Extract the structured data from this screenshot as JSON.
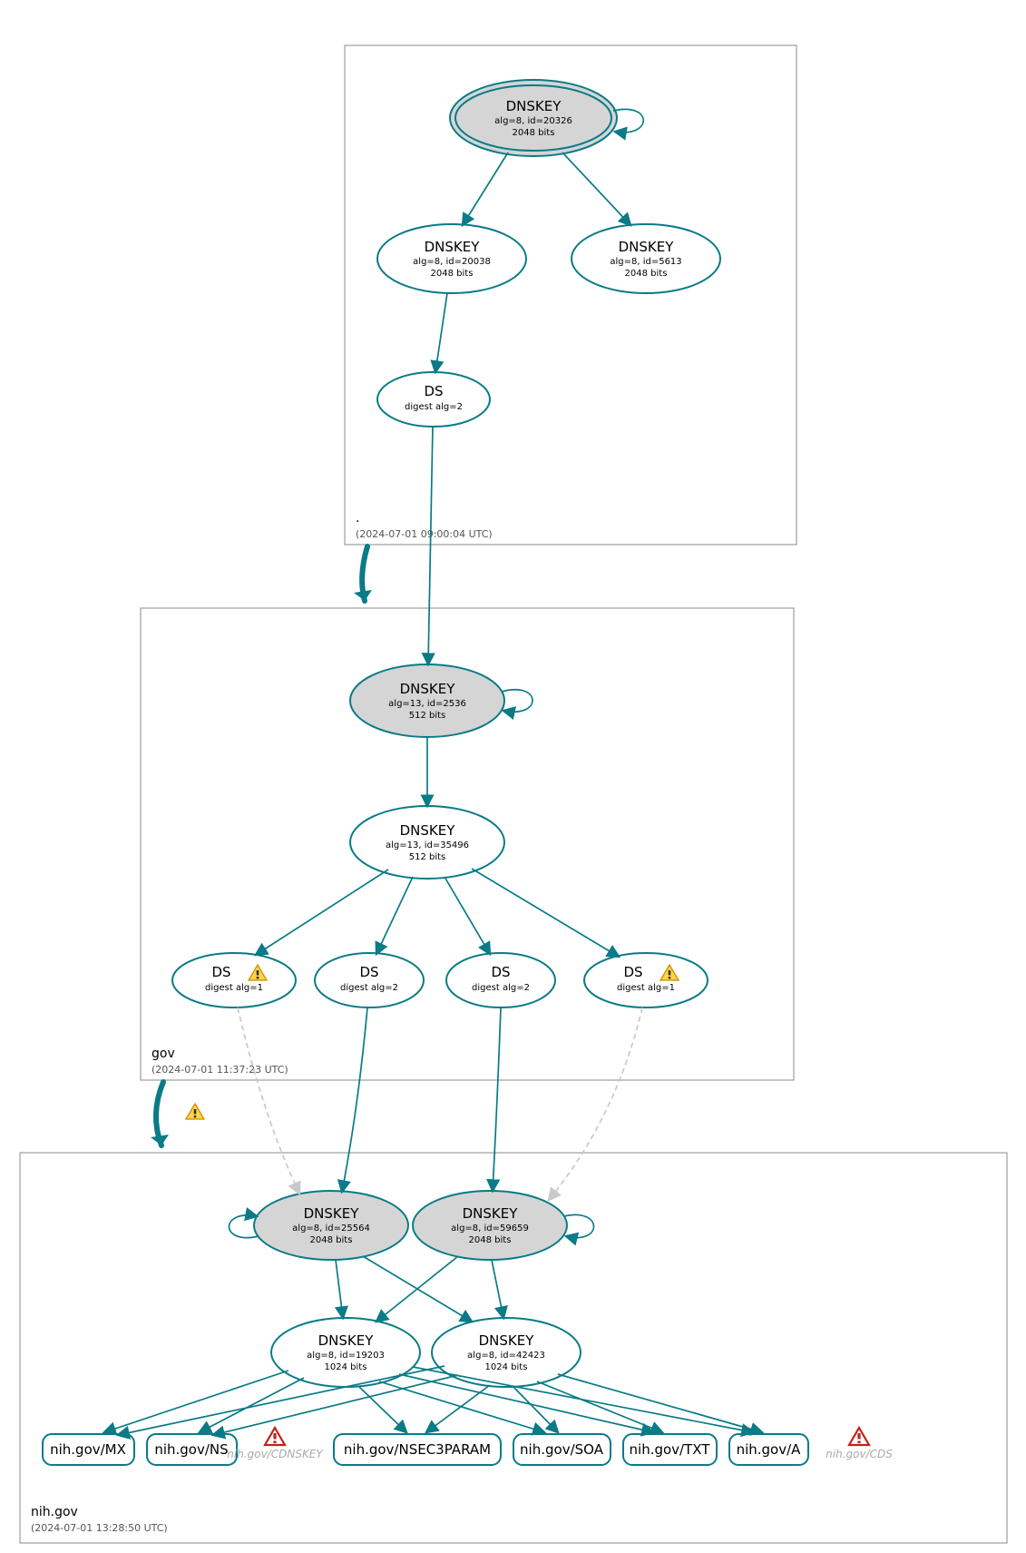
{
  "zones": {
    "root": {
      "label": ".",
      "timestamp": "(2024-07-01 09:00:04 UTC)"
    },
    "gov": {
      "label": "gov",
      "timestamp": "(2024-07-01 11:37:23 UTC)"
    },
    "nih": {
      "label": "nih.gov",
      "timestamp": "(2024-07-01 13:28:50 UTC)"
    }
  },
  "nodes": {
    "root_ksk": {
      "title": "DNSKEY",
      "l2": "alg=8, id=20326",
      "l3": "2048 bits"
    },
    "root_zsk1": {
      "title": "DNSKEY",
      "l2": "alg=8, id=20038",
      "l3": "2048 bits"
    },
    "root_zsk2": {
      "title": "DNSKEY",
      "l2": "alg=8, id=5613",
      "l3": "2048 bits"
    },
    "root_ds": {
      "title": "DS",
      "l2": "digest alg=2",
      "l3": ""
    },
    "gov_ksk": {
      "title": "DNSKEY",
      "l2": "alg=13, id=2536",
      "l3": "512 bits"
    },
    "gov_zsk": {
      "title": "DNSKEY",
      "l2": "alg=13, id=35496",
      "l3": "512 bits"
    },
    "gov_ds1": {
      "title": "DS",
      "l2": "digest alg=1",
      "l3": ""
    },
    "gov_ds2": {
      "title": "DS",
      "l2": "digest alg=2",
      "l3": ""
    },
    "gov_ds3": {
      "title": "DS",
      "l2": "digest alg=2",
      "l3": ""
    },
    "gov_ds4": {
      "title": "DS",
      "l2": "digest alg=1",
      "l3": ""
    },
    "nih_ksk1": {
      "title": "DNSKEY",
      "l2": "alg=8, id=25564",
      "l3": "2048 bits"
    },
    "nih_ksk2": {
      "title": "DNSKEY",
      "l2": "alg=8, id=59659",
      "l3": "2048 bits"
    },
    "nih_zsk1": {
      "title": "DNSKEY",
      "l2": "alg=8, id=19203",
      "l3": "1024 bits"
    },
    "nih_zsk2": {
      "title": "DNSKEY",
      "l2": "alg=8, id=42423",
      "l3": "1024 bits"
    }
  },
  "rr": {
    "mx": "nih.gov/MX",
    "ns": "nih.gov/NS",
    "cdk": "nih.gov/CDNSKEY",
    "n3p": "nih.gov/NSEC3PARAM",
    "soa": "nih.gov/SOA",
    "txt": "nih.gov/TXT",
    "a": "nih.gov/A",
    "cds": "nih.gov/CDS"
  },
  "colors": {
    "stroke": "#0a7b87",
    "fill_grey": "#d5d5d5"
  }
}
